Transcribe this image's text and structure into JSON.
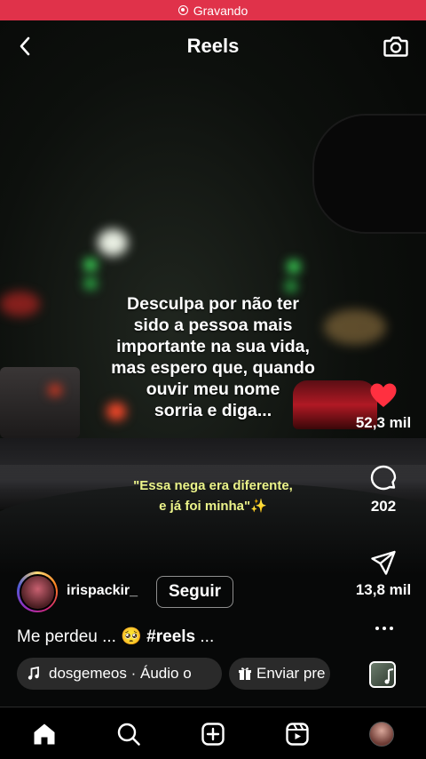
{
  "status_bar": {
    "recording_label": "Gravando"
  },
  "header": {
    "title": "Reels"
  },
  "overlay": {
    "main_text": "Desculpa por não ter\nsido a pessoa mais\nimportante na sua vida,\nmas espero que, quando\nouvir meu nome\nsorria e diga...",
    "quote_text": "\"Essa nega era diferente,\ne já foi minha\"✨"
  },
  "actions": {
    "likes": "52,3 mil",
    "comments": "202",
    "shares": "13,8 mil"
  },
  "author": {
    "username": "irispackir_",
    "follow_label": "Seguir"
  },
  "caption": {
    "text": "Me perdeu ... 🥺",
    "hashtag": "#reels",
    "more": "..."
  },
  "audio": {
    "label": "dosgemeos · Áudio o"
  },
  "gift": {
    "label": "Enviar pre"
  },
  "colors": {
    "recording_bar": "#e0324a",
    "like_heart": "#ff3040",
    "quote_text": "#ecf48a"
  },
  "nav": {
    "items": [
      "home-icon",
      "search-icon",
      "create-icon",
      "reels-icon",
      "profile-avatar"
    ]
  }
}
